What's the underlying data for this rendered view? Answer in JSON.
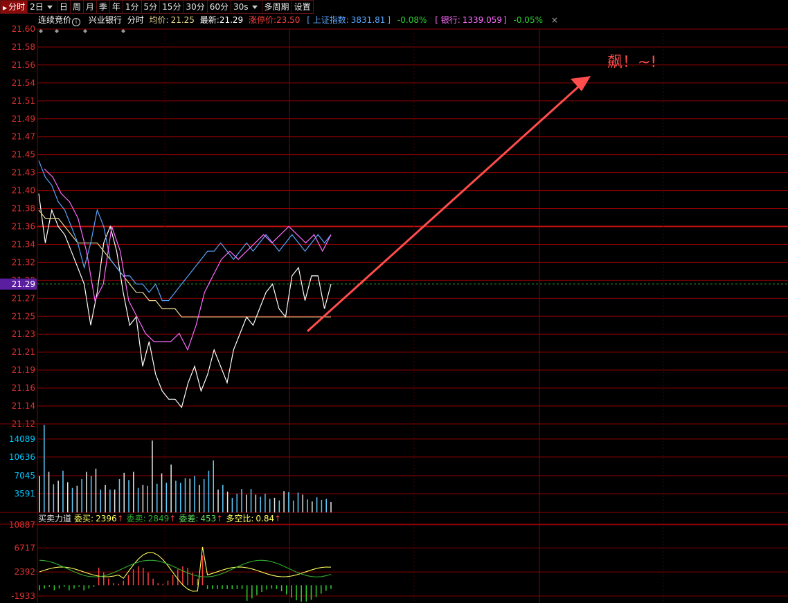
{
  "toolbar": {
    "items": [
      {
        "label": "分时",
        "active": true,
        "icon": "play-icon"
      },
      {
        "label": "2日",
        "dropdown": true
      },
      {
        "label": "日"
      },
      {
        "label": "周"
      },
      {
        "label": "月"
      },
      {
        "label": "季"
      },
      {
        "label": "年"
      },
      {
        "label": "1分"
      },
      {
        "label": "5分"
      },
      {
        "label": "15分"
      },
      {
        "label": "30分"
      },
      {
        "label": "60分"
      },
      {
        "label": "30s",
        "dropdown": true
      },
      {
        "label": "多周期"
      },
      {
        "label": "设置"
      }
    ]
  },
  "info": {
    "auction_label": "连续竞价",
    "stock_name": "兴业银行",
    "mode": "分时",
    "avg_label": "均价:",
    "avg_value": "21.25",
    "last_label": "最新:",
    "last_value": "21.29",
    "limit_label": "涨停价:",
    "limit_value": "23.50",
    "sh_label": "[ 上证指数:",
    "sh_value": "3831.81",
    "sh_close": "]",
    "sh_change": "-0.08%",
    "bank_label": "[ 银行:",
    "bank_value": "1339.059",
    "bank_close": "]",
    "bank_change": "-0.05%",
    "close_mark": "×"
  },
  "colors": {
    "background": "#000000",
    "grid": "#8b0000",
    "grid_dotted": "#4a0000",
    "price_axis": "#e03030",
    "volume_axis": "#00c8ff",
    "price_line": "#ffffff",
    "avg_line": "#e8d890",
    "sh_index_line": "#5aa6ff",
    "bank_index_line": "#ff6cff",
    "up": "#ff4040",
    "down": "#30d030",
    "annotation": "#ff4d4d",
    "highlight_price_bg": "#5a1fa0"
  },
  "annotation": {
    "text": "飙！~!"
  },
  "chart_data": {
    "type": "line",
    "price_axis": {
      "ticks": [
        "21.60",
        "21.58",
        "21.56",
        "21.54",
        "21.51",
        "21.49",
        "21.47",
        "21.45",
        "21.43",
        "21.40",
        "21.38",
        "21.36",
        "21.34",
        "21.32",
        "21.29",
        "21.27",
        "21.25",
        "21.23",
        "21.21",
        "21.19",
        "21.16",
        "21.14",
        "21.12"
      ],
      "ylim": [
        21.12,
        21.6
      ],
      "highlight": "21.29",
      "prev_close": 21.36
    },
    "series": [
      {
        "values": [
          21.4,
          21.34,
          21.38,
          21.36,
          21.35,
          21.33,
          21.31,
          21.29,
          21.24,
          21.28,
          21.34,
          21.36,
          21.33,
          21.28,
          21.24,
          21.25,
          21.19,
          21.22,
          21.18,
          21.16,
          21.15,
          21.15,
          21.14,
          21.17,
          21.19,
          21.16,
          21.18,
          21.21,
          21.19,
          21.17,
          21.21,
          21.23,
          21.25,
          21.24,
          21.26,
          21.28,
          21.29,
          21.26,
          21.25,
          21.3,
          21.31,
          21.27,
          21.3,
          21.3,
          21.26,
          21.29
        ]
      },
      {
        "values": [
          21.38,
          21.37,
          21.37,
          21.37,
          21.36,
          21.35,
          21.34,
          21.34,
          21.34,
          21.34,
          21.33,
          21.32,
          21.31,
          21.3,
          21.29,
          21.28,
          21.28,
          21.27,
          21.27,
          21.26,
          21.26,
          21.26,
          21.25,
          21.25,
          21.25,
          21.25,
          21.25,
          21.25,
          21.25,
          21.25,
          21.25,
          21.25,
          21.25,
          21.25,
          21.25,
          21.25,
          21.25,
          21.25,
          21.25,
          21.25,
          21.25,
          21.25,
          21.25,
          21.25,
          21.25,
          21.25
        ]
      },
      {
        "values": [
          21.44,
          21.42,
          21.41,
          21.39,
          21.38,
          21.36,
          21.34,
          21.31,
          21.34,
          21.38,
          21.36,
          21.32,
          21.31,
          21.3,
          21.3,
          21.29,
          21.29,
          21.28,
          21.29,
          21.27,
          21.27,
          21.28,
          21.29,
          21.3,
          21.31,
          21.32,
          21.33,
          21.33,
          21.34,
          21.33,
          21.32,
          21.33,
          21.34,
          21.33,
          21.34,
          21.35,
          21.34,
          21.33,
          21.34,
          21.35,
          21.34,
          21.33,
          21.34,
          21.35,
          21.34,
          21.35
        ]
      },
      {
        "values": [
          21.43,
          21.42,
          21.4,
          21.39,
          21.37,
          21.33,
          21.27,
          21.29,
          21.36,
          21.33,
          21.27,
          21.25,
          21.23,
          21.22,
          21.22,
          21.22,
          21.23,
          21.21,
          21.24,
          21.28,
          21.3,
          21.32,
          21.33,
          21.32,
          21.33,
          21.34,
          21.35,
          21.34,
          21.35,
          21.36,
          21.35,
          21.34,
          21.35,
          21.33,
          21.35
        ]
      }
    ],
    "volume": {
      "ticks": [
        "14089",
        "10636",
        "7045",
        "3591"
      ],
      "ylim": [
        0,
        17000
      ],
      "values": [
        7000,
        16800,
        7800,
        5400,
        6100,
        8000,
        5800,
        4700,
        5100,
        6400,
        7800,
        7000,
        8400,
        4400,
        5300,
        4400,
        4400,
        6400,
        7600,
        6200,
        7800,
        4700,
        5300,
        5100,
        13800,
        5500,
        7500,
        5700,
        9200,
        6100,
        5700,
        6600,
        6500,
        7000,
        5300,
        6400,
        8000,
        10000,
        4400,
        5300,
        4000,
        2800,
        3600,
        4500,
        3400,
        4500,
        3400,
        3000,
        3600,
        2600,
        2800,
        2300,
        4100,
        3900,
        2300,
        3800,
        3400,
        2500,
        2100,
        2900,
        2400,
        2600,
        2000
      ]
    },
    "order_flow": {
      "title": "买卖力道",
      "buy_label": "委买:",
      "buy_value": "2396",
      "sell_label": "委卖:",
      "sell_value": "2849",
      "diff_label": "委差:",
      "diff_value": "453",
      "ratio_label": "多空比:",
      "ratio_value": "0.84",
      "arrow": "↑",
      "ticks": [
        "10887",
        "6717",
        "2392",
        "-1933"
      ],
      "ylim": [
        -3200,
        11000
      ]
    }
  }
}
